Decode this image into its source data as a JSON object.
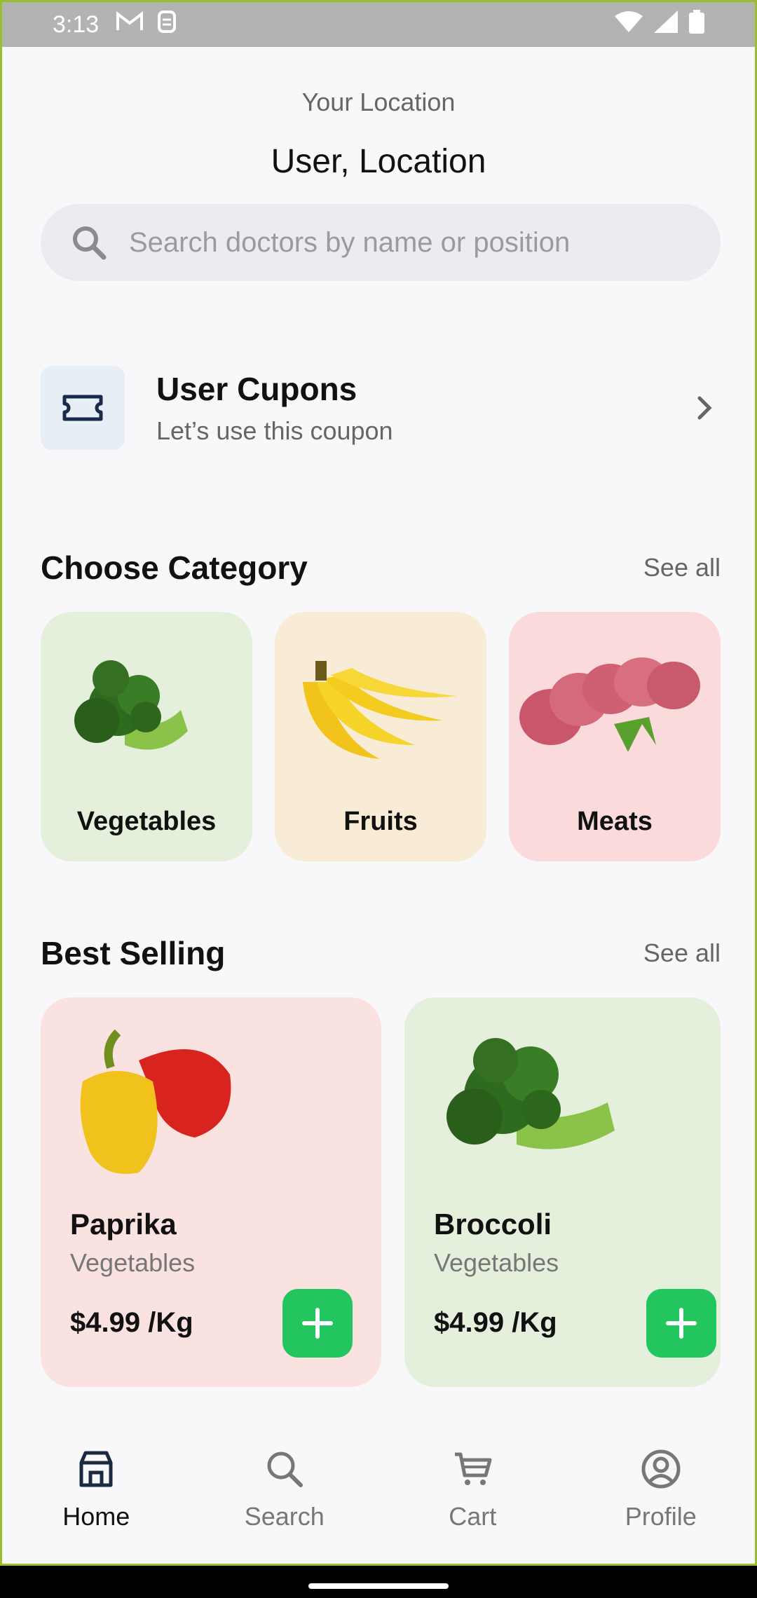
{
  "status_bar": {
    "time": "3:13"
  },
  "header": {
    "location_label": "Your Location",
    "location_value": "User, Location"
  },
  "search": {
    "placeholder": "Search doctors by name or position"
  },
  "coupon": {
    "title": "User Cupons",
    "subtitle": "Let’s use this coupon"
  },
  "categories": {
    "title": "Choose Category",
    "see_all": "See all",
    "items": [
      {
        "label": "Vegetables",
        "bg": "#e4efdc"
      },
      {
        "label": "Fruits",
        "bg": "#f9ecd6"
      },
      {
        "label": "Meats",
        "bg": "#fadadb"
      }
    ]
  },
  "best_selling": {
    "title": "Best Selling",
    "see_all": "See all",
    "items": [
      {
        "name": "Paprika",
        "category": "Vegetables",
        "price": "$4.99 /Kg",
        "bg": "#f9e2e0"
      },
      {
        "name": "Broccoli",
        "category": "Vegetables",
        "price": "$4.99 /Kg",
        "bg": "#e4efdc"
      }
    ]
  },
  "nav": {
    "items": [
      {
        "label": "Home",
        "icon": "store-icon",
        "active": true
      },
      {
        "label": "Search",
        "icon": "search-icon",
        "active": false
      },
      {
        "label": "Cart",
        "icon": "cart-icon",
        "active": false
      },
      {
        "label": "Profile",
        "icon": "profile-icon",
        "active": false
      }
    ]
  },
  "colors": {
    "accent_green": "#22c55e",
    "text_dark": "#111111",
    "text_muted": "#666666"
  }
}
